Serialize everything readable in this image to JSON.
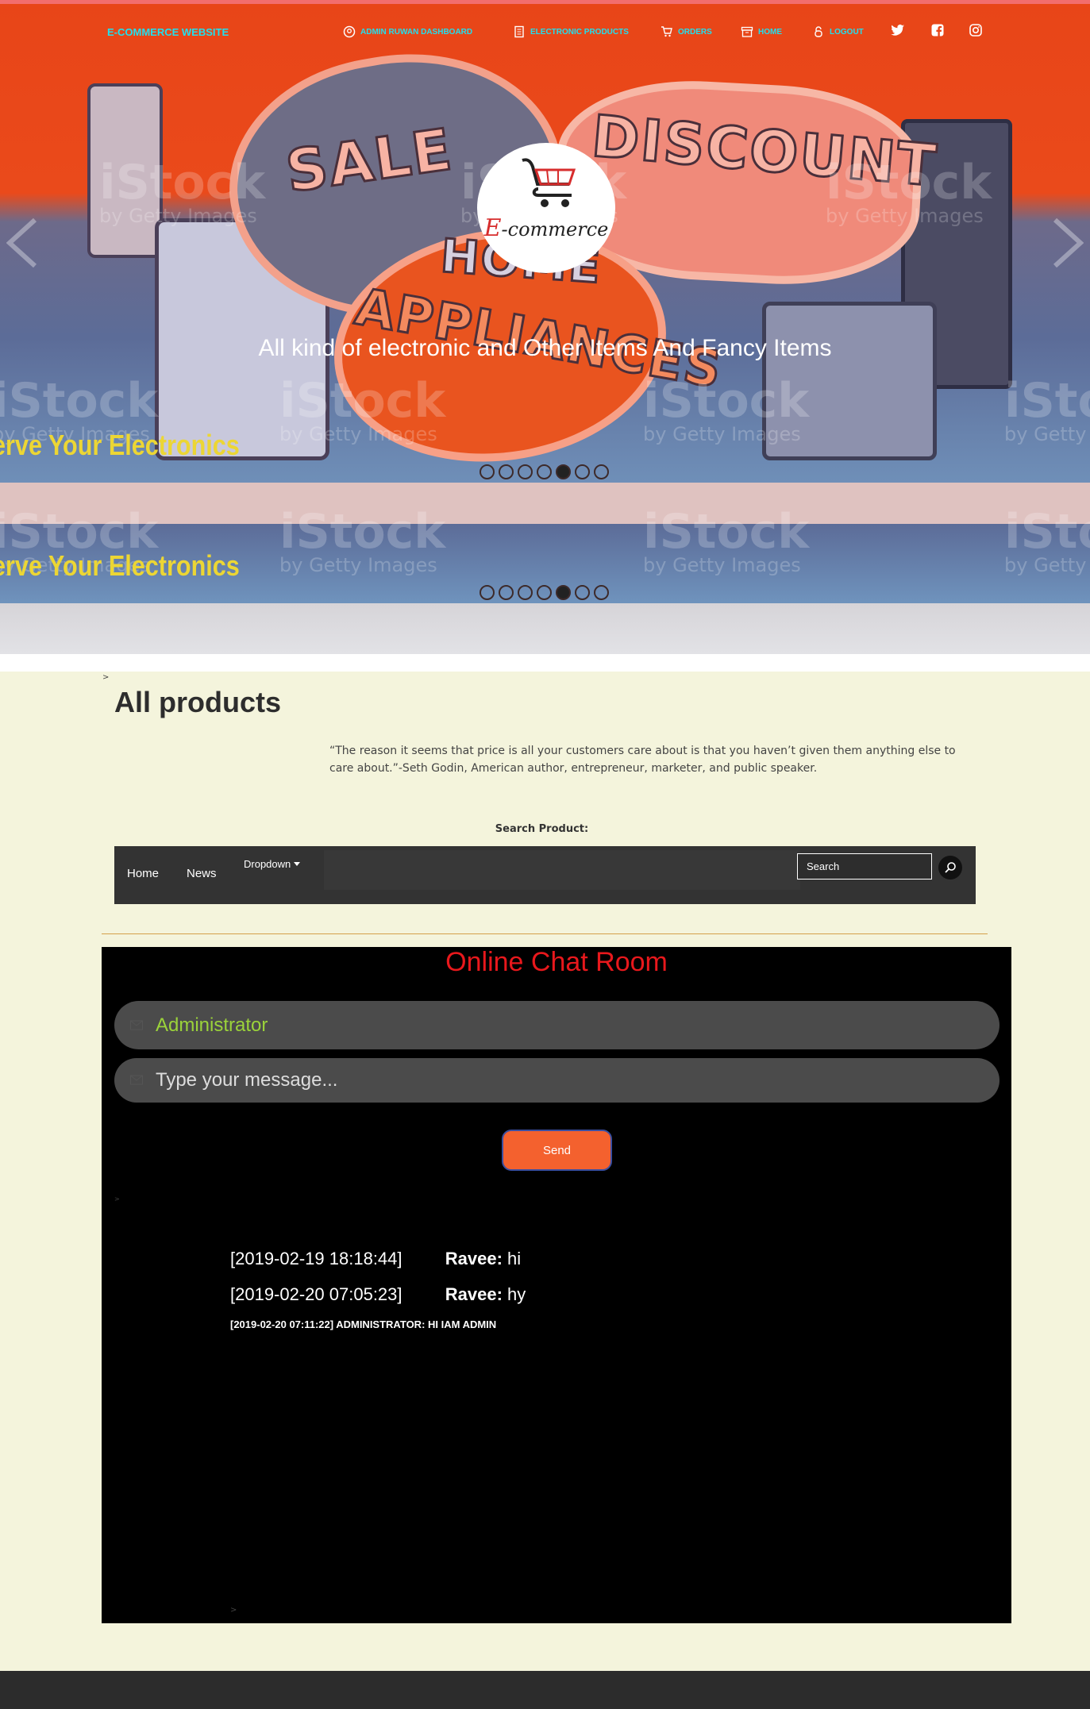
{
  "nav": {
    "brand": "E-COMMERCE WEBSITE",
    "items": [
      {
        "label": "ADMIN RUWAN DASHBOARD",
        "icon": "user-circle-icon"
      },
      {
        "label": "ELECTRONIC PRODUCTS",
        "icon": "document-icon"
      },
      {
        "label": "ORDERS",
        "icon": "cart-icon"
      },
      {
        "label": "HOME",
        "icon": "archive-icon"
      },
      {
        "label": "LOGOUT",
        "icon": "lock-icon"
      }
    ],
    "social": [
      "twitter-icon",
      "facebook-icon",
      "instagram-icon"
    ],
    "accent": "#20e0ee"
  },
  "hero": {
    "logo_letter": "E",
    "logo_text": "-commerce",
    "caption": "All kind of electronic and Other Items And Fancy Items",
    "image_words": [
      "SALE",
      "DISCOUNT",
      "HOME",
      "APPLIANCES"
    ],
    "watermark": "iStock",
    "watermark_sub": "by Getty Images",
    "tagline": "erve Your Electronics",
    "slides": 7,
    "active_slide": 5
  },
  "page": {
    "breadcrumb": ">",
    "title": "All products",
    "quote": "“The reason it seems that price is all your customers care about is that you haven’t given them anything else to care about.”-Seth Godin, American author, entrepreneur, marketer, and public speaker.",
    "search_label": "Search Product:"
  },
  "navbar": {
    "links": [
      "Home",
      "News",
      "Dropdown"
    ],
    "search_placeholder": "Search"
  },
  "chat": {
    "title": "Online Chat Room",
    "name_value": "Administrator",
    "message_placeholder": "Type your message...",
    "send_label": "Send",
    "breadcrumb": ">",
    "messages": [
      {
        "time": "[2019-02-19 18:18:44]",
        "user": "Ravee:",
        "text": "hi"
      },
      {
        "time": "[2019-02-20 07:05:23]",
        "user": "Ravee:",
        "text": "hy"
      }
    ],
    "admin_message": "[2019-02-20 07:11:22] ADMINISTRATOR: HI IAM ADMIN",
    "footer_crumb": ">"
  }
}
